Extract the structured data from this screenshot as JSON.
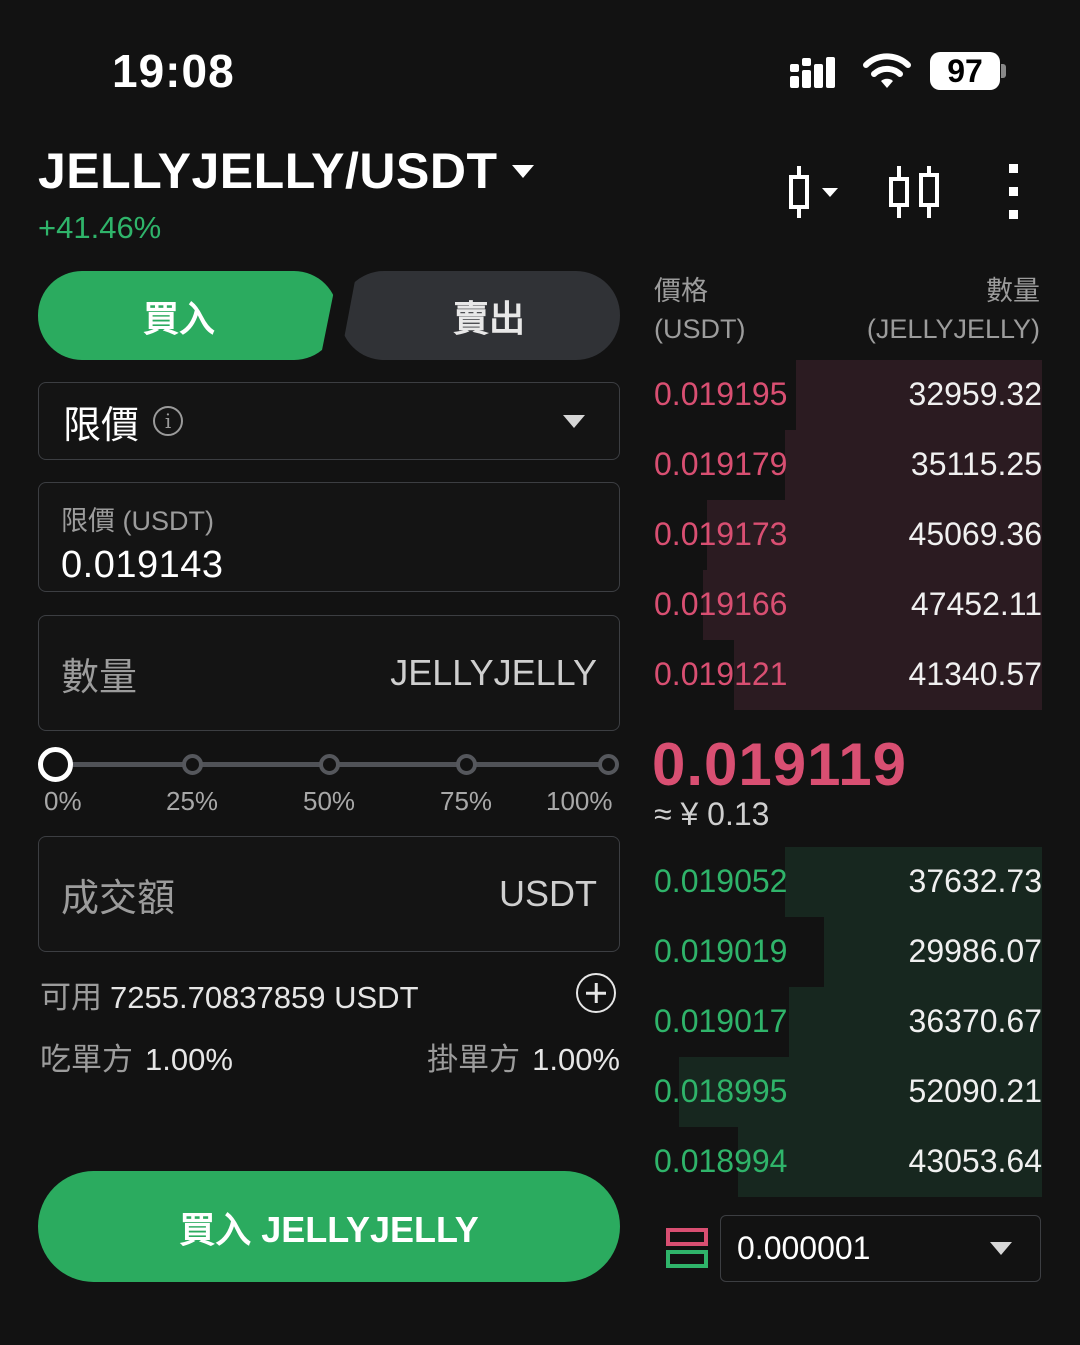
{
  "status_bar": {
    "time": "19:08",
    "battery": "97"
  },
  "header": {
    "pair": "JELLYJELLY/USDT",
    "change": "+41.46%"
  },
  "tabs": {
    "buy": "買入",
    "sell": "賣出"
  },
  "order_type": {
    "label": "限價",
    "info": "i"
  },
  "price_field": {
    "label": "限價 (USDT)",
    "value": "0.019143"
  },
  "quantity_field": {
    "placeholder": "數量",
    "unit": "JELLYJELLY"
  },
  "slider": {
    "value_fraction": 0,
    "marks": [
      "0%",
      "25%",
      "50%",
      "75%",
      "100%"
    ]
  },
  "amount_field": {
    "placeholder": "成交額",
    "unit": "USDT"
  },
  "available": {
    "label": "可用",
    "value": "7255.70837859 USDT"
  },
  "fees": {
    "taker_label": "吃單方",
    "taker_value": "1.00%",
    "maker_label": "掛單方",
    "maker_value": "1.00%"
  },
  "buy_button": {
    "label": "買入 JELLYJELLY"
  },
  "orderbook": {
    "price_header": "價格",
    "price_unit": "(USDT)",
    "qty_header": "數量",
    "qty_unit": "(JELLYJELLY)",
    "asks": [
      {
        "price": "0.019195",
        "qty": "32959.32",
        "depth": 0.63
      },
      {
        "price": "0.019179",
        "qty": "35115.25",
        "depth": 0.66
      },
      {
        "price": "0.019173",
        "qty": "45069.36",
        "depth": 0.86
      },
      {
        "price": "0.019166",
        "qty": "47452.11",
        "depth": 0.87
      },
      {
        "price": "0.019121",
        "qty": "41340.57",
        "depth": 0.79
      }
    ],
    "last_price": "0.019119",
    "last_price_fiat": "≈ ¥ 0.13",
    "bids": [
      {
        "price": "0.019052",
        "qty": "37632.73",
        "depth": 0.66
      },
      {
        "price": "0.019019",
        "qty": "29986.07",
        "depth": 0.56
      },
      {
        "price": "0.019017",
        "qty": "36370.67",
        "depth": 0.65
      },
      {
        "price": "0.018995",
        "qty": "52090.21",
        "depth": 0.93
      },
      {
        "price": "0.018994",
        "qty": "43053.64",
        "depth": 0.78
      }
    ],
    "precision": "0.000001"
  },
  "colors": {
    "buy": "#2bab5f",
    "ask": "#d94f72",
    "bid": "#2fb46a",
    "background": "#121212"
  },
  "icons": [
    "signal-icon",
    "wifi-icon",
    "battery-icon",
    "caret-down-icon",
    "candlestick-chart-icon",
    "compare-chart-icon",
    "more-vertical-icon",
    "info-icon",
    "plus-circle-icon",
    "depth-view-icon"
  ]
}
